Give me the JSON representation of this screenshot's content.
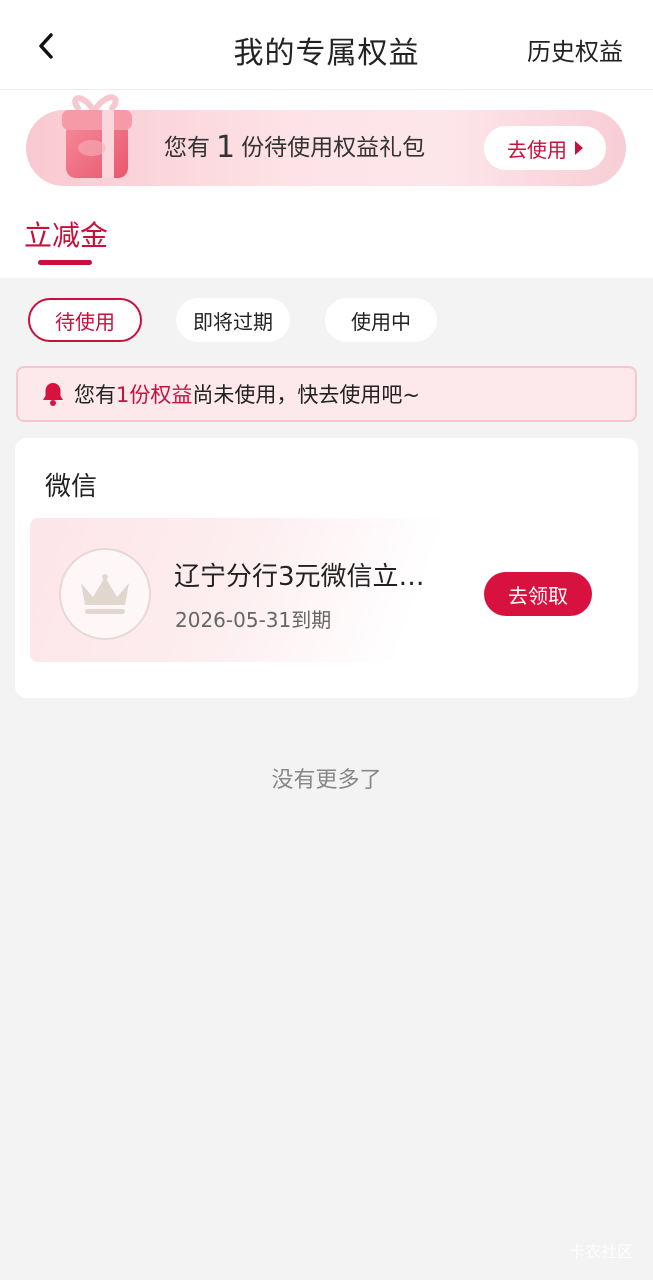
{
  "header": {
    "title": "我的专属权益",
    "history_label": "历史权益"
  },
  "banner": {
    "prefix": "您有",
    "count": "1",
    "suffix": "份待使用权益礼包",
    "button_label": "去使用"
  },
  "tabs": [
    {
      "label": "立减金",
      "active": true
    }
  ],
  "filters": [
    {
      "label": "待使用",
      "active": true
    },
    {
      "label": "即将过期",
      "active": false
    },
    {
      "label": "使用中",
      "active": false
    }
  ],
  "notice": {
    "prefix": "您有",
    "highlight": "1份权益",
    "suffix": "尚未使用，快去使用吧~"
  },
  "section": {
    "title": "微信",
    "items": [
      {
        "name": "辽宁分行3元微信立…",
        "expiry": "2026-05-31到期",
        "button_label": "去领取"
      }
    ]
  },
  "footer": {
    "no_more": "没有更多了",
    "watermark": "卡农社区"
  },
  "colors": {
    "accent": "#c8103c",
    "button_red": "#d8123f",
    "background": "#f3f3f3"
  }
}
